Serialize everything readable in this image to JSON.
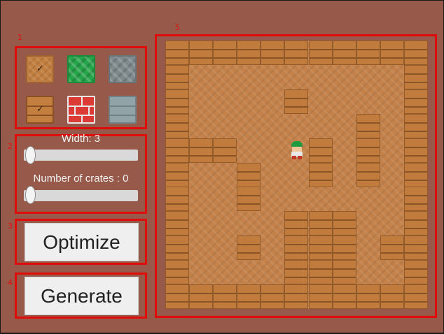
{
  "sections": {
    "palette_label": "1",
    "sliders_label": "2",
    "optimize_label": "3",
    "generate_label": "4",
    "board_label": "5"
  },
  "palette": {
    "tiles": [
      {
        "name": "wood-floor-tile",
        "style": "wood",
        "checked": true
      },
      {
        "name": "grass-tile",
        "style": "grass",
        "checked": false
      },
      {
        "name": "stone-tile",
        "style": "stone",
        "checked": false
      },
      {
        "name": "crate-tile",
        "style": "crate",
        "checked": true
      },
      {
        "name": "brick-wall-tile",
        "style": "brick",
        "checked": false
      },
      {
        "name": "metal-wall-tile",
        "style": "metal",
        "checked": false
      }
    ],
    "check_glyph": "✓"
  },
  "sliders": {
    "width_label": "Width: 3",
    "width_value": 3,
    "crates_label": "Number of crates : 0",
    "crates_value": 0
  },
  "buttons": {
    "optimize_label": "Optimize",
    "generate_label": "Generate"
  },
  "board": {
    "cols": 11,
    "rows": 11,
    "grid": [
      "WWWWWWWWWWW",
      "W.........W",
      "W....W....W",
      "W.......W.W",
      "WWW...W.W.W",
      "W..W..W.W.W",
      "W..W......W",
      "W....WWW..W",
      "W..W.WWW.WW",
      "W....WWW..W",
      "WWWWWWWWWWW"
    ],
    "player": {
      "col": 5,
      "row": 4,
      "icon": "player-character-icon"
    }
  },
  "colors": {
    "background": "#96594a",
    "section_border": "#e00c0c",
    "floor": "#c4824a",
    "wall": "#c07b3d"
  }
}
